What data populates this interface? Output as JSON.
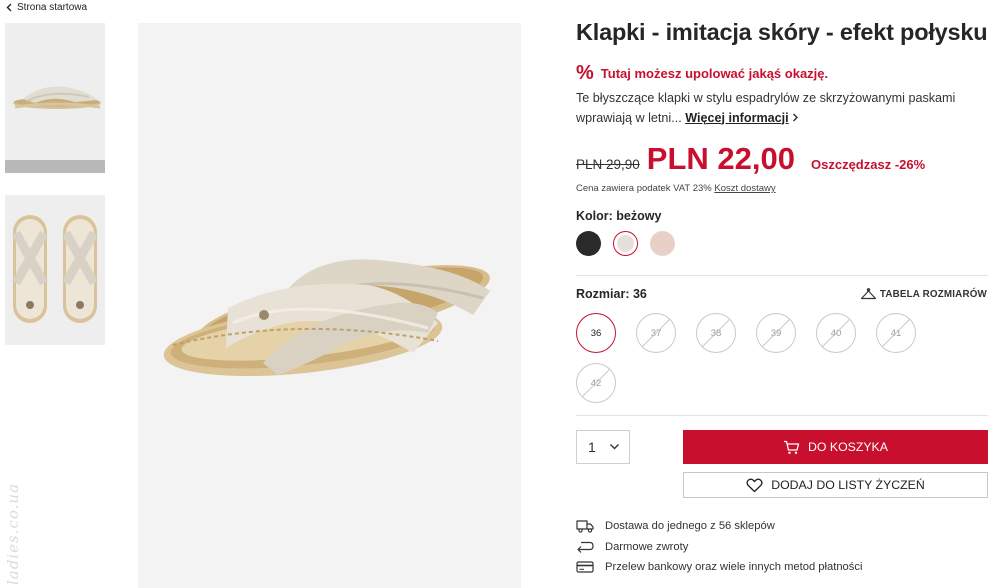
{
  "nav": {
    "back_label": "Strona startowa"
  },
  "product": {
    "title": "Klapki - imitacja skóry - efekt połysku",
    "promo_icon": "%",
    "promo": "Tutaj możesz upolować jakąś okazję.",
    "description": "Te błyszczące klapki w stylu espadrylów ze skrzyżowanymi paskami wprawiają w letni...",
    "more_label": "Więcej informacji",
    "old_price": "PLN 29,90",
    "price": "PLN 22,00",
    "savings": "Oszczędzasz -26%",
    "vat_note": "Cena zawiera podatek VAT 23%",
    "shipping_link": "Koszt dostawy"
  },
  "color": {
    "label": "Kolor: beżowy",
    "swatches": [
      {
        "name": "black",
        "hex": "#2a2a2a"
      },
      {
        "name": "beige",
        "hex": "#e6dfdb",
        "selected": true
      },
      {
        "name": "pink",
        "hex": "#e9cfc6"
      }
    ]
  },
  "size": {
    "label": "Rozmiar: 36",
    "table_label": "TABELA ROZMIARÓW",
    "options": [
      {
        "label": "36",
        "available": true,
        "selected": true
      },
      {
        "label": "37",
        "available": false
      },
      {
        "label": "38",
        "available": false
      },
      {
        "label": "39",
        "available": false
      },
      {
        "label": "40",
        "available": false
      },
      {
        "label": "41",
        "available": false
      },
      {
        "label": "42",
        "available": false
      }
    ]
  },
  "purchase": {
    "quantity": "1",
    "cart_label": "DO KOSZYKA",
    "wishlist_label": "DODAJ DO LISTY ŻYCZEŃ"
  },
  "features": [
    {
      "icon": "truck-icon",
      "text": "Dostawa do jednego z 56 sklepów"
    },
    {
      "icon": "return-icon",
      "text": "Darmowe zwroty"
    },
    {
      "icon": "card-icon",
      "text": "Przelew bankowy oraz wiele innych metod płatności"
    }
  ],
  "watermark": "ladies.co.ua",
  "colors": {
    "accent": "#c8102e",
    "image_bg": "#f3f3f3"
  }
}
